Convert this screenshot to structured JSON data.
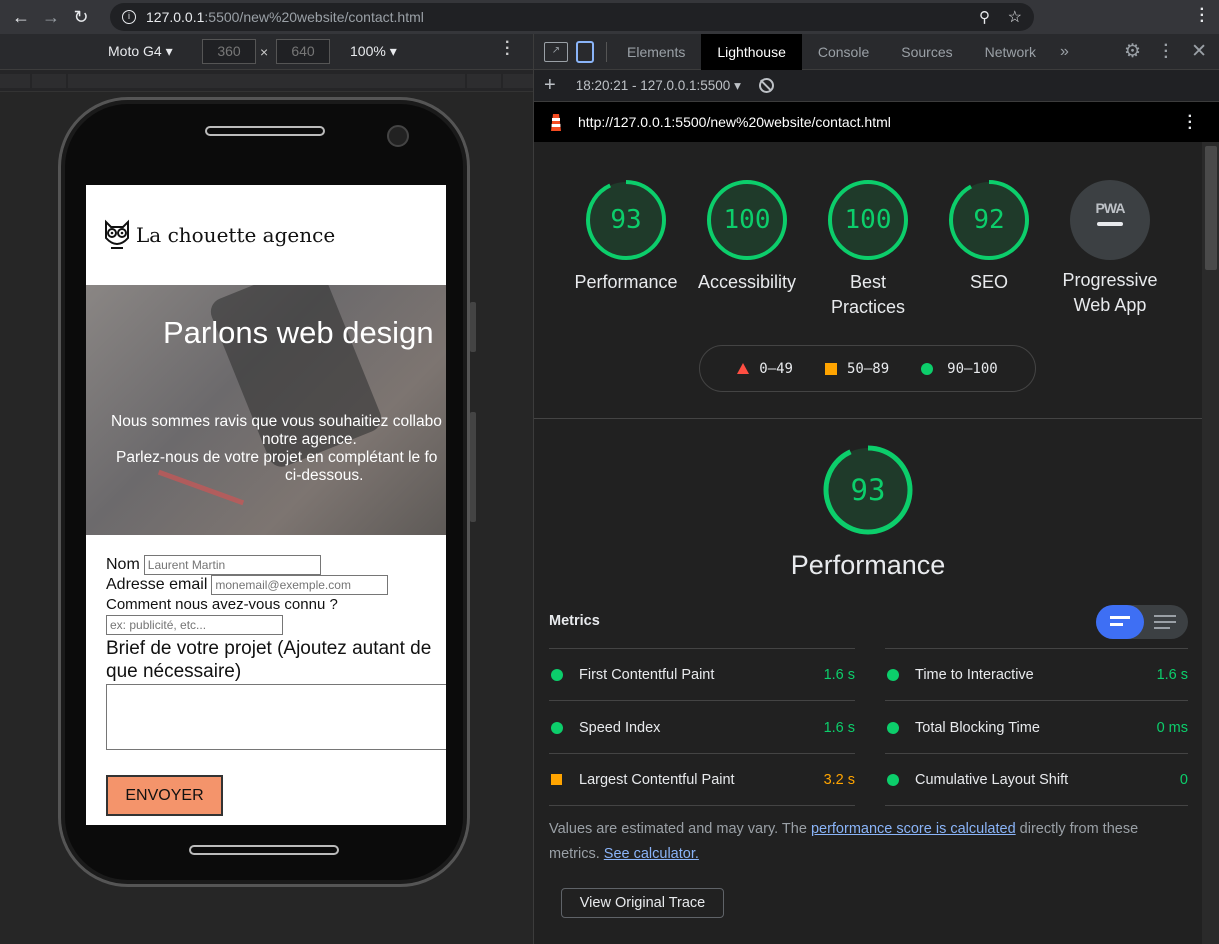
{
  "browser": {
    "url_host": "127.0.0.1",
    "url_path": ":5500/new%20website/contact.html"
  },
  "device_toolbar": {
    "device": "Moto G4",
    "width": "360",
    "height": "640",
    "zoom": "100%"
  },
  "site": {
    "logo_text": "La chouette agence",
    "hero_title": "Parlons web design",
    "hero_text_1": "Nous sommes ravis que vous souhaitiez collabo",
    "hero_text_2": "notre agence.",
    "hero_text_3": "Parlez-nous de votre projet en complétant le fo",
    "hero_text_4": "ci-dessous.",
    "form": {
      "name_label": "Nom",
      "name_placeholder": "Laurent Martin",
      "email_label": "Adresse email",
      "email_placeholder": "monemail@exemple.com",
      "source_label": "Comment nous avez-vous connu ?",
      "source_placeholder": "ex: publicité, etc...",
      "brief_label": "Brief de votre projet (Ajoutez autant de",
      "brief_label_2": "que nécessaire)",
      "submit": "ENVOYER"
    }
  },
  "devtools": {
    "tabs": [
      "Elements",
      "Lighthouse",
      "Console",
      "Sources",
      "Network"
    ],
    "active_tab": "Lighthouse",
    "report_select": "18:20:21 - 127.0.0.1:5500",
    "report_url": "http://127.0.0.1:5500/new%20website/contact.html"
  },
  "lighthouse": {
    "gauges": [
      {
        "label": "Performance",
        "score": 93
      },
      {
        "label": "Accessibility",
        "score": 100
      },
      {
        "label": "Best",
        "label2": "Practices",
        "score": 100
      },
      {
        "label": "SEO",
        "score": 92
      }
    ],
    "pwa": {
      "badge": "PWA",
      "label": "Progressive",
      "label2": "Web App"
    },
    "legend": {
      "bad": "0–49",
      "avg": "50–89",
      "good": "90–100"
    },
    "perf_score": 93,
    "perf_title": "Performance",
    "metrics_title": "Metrics",
    "metrics_left": [
      {
        "name": "First Contentful Paint",
        "value": "1.6 s",
        "status": "good"
      },
      {
        "name": "Speed Index",
        "value": "1.6 s",
        "status": "good"
      },
      {
        "name": "Largest Contentful Paint",
        "value": "3.2 s",
        "status": "average"
      }
    ],
    "metrics_right": [
      {
        "name": "Time to Interactive",
        "value": "1.6 s",
        "status": "good"
      },
      {
        "name": "Total Blocking Time",
        "value": "0 ms",
        "status": "good"
      },
      {
        "name": "Cumulative Layout Shift",
        "value": "0",
        "status": "good"
      }
    ],
    "note_1": "Values are estimated and may vary. The ",
    "note_link_1": "performance score is calculated",
    "note_2": " directly from these",
    "note_3": "metrics. ",
    "note_link_2": "See calculator.",
    "view_trace": "View Original Trace"
  },
  "colors": {
    "good": "#0cce6b",
    "average": "#ffa400",
    "bad": "#ff4e42",
    "accent": "#3e6ff4",
    "submit_bg": "#f4946b"
  }
}
